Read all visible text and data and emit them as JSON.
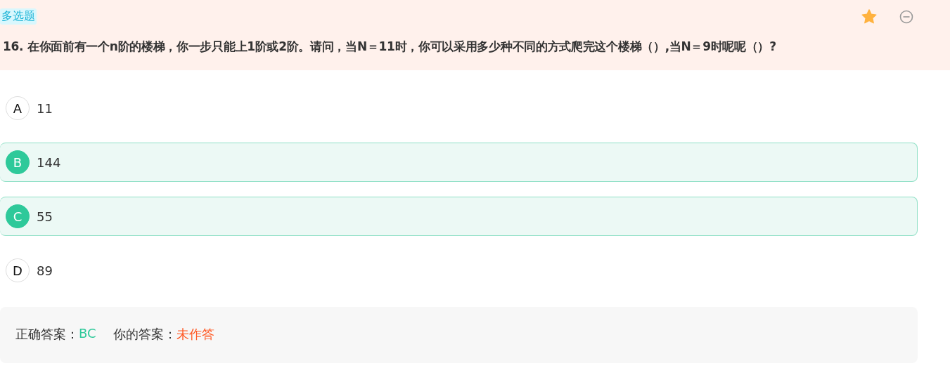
{
  "question": {
    "type_tag": "多选题",
    "starred": true,
    "text": "16. 在你面前有一个n阶的楼梯，你一步只能上1阶或2阶。请问，当N＝11时，你可以采用多少种不同的方式爬完这个楼梯（）,当N＝9时呢呢（）?"
  },
  "options": [
    {
      "letter": "A",
      "text": "11",
      "selected": false
    },
    {
      "letter": "B",
      "text": "144",
      "selected": true
    },
    {
      "letter": "C",
      "text": "55",
      "selected": true
    },
    {
      "letter": "D",
      "text": "89",
      "selected": false
    }
  ],
  "answer": {
    "correct_label": "正确答案：",
    "correct_value": "BC",
    "yours_label": "你的答案：",
    "yours_value": "未作答"
  }
}
